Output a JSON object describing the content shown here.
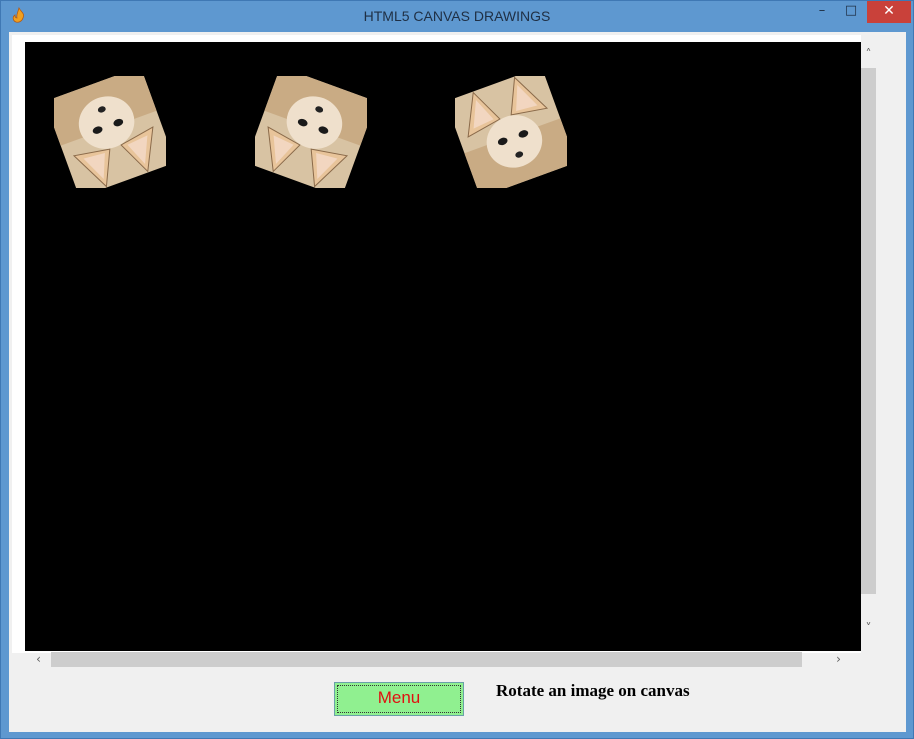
{
  "window": {
    "title": "HTML5 CANVAS DRAWINGS",
    "icon": "app-flame-icon",
    "controls": {
      "minimize": "minimize-icon",
      "maximize": "maximize-icon",
      "close": "close-icon"
    }
  },
  "canvas": {
    "background": "#000000",
    "images": [
      {
        "name": "rotated-fox-1",
        "rotation_deg": 160
      },
      {
        "name": "rotated-fox-2",
        "rotation_deg": 200
      },
      {
        "name": "rotated-fox-3",
        "rotation_deg": -20
      }
    ]
  },
  "scrollbars": {
    "vertical": true,
    "horizontal": true
  },
  "footer": {
    "menu_label": "Menu",
    "caption": "Rotate an image on canvas"
  },
  "colors": {
    "menu_bg": "#90f090",
    "menu_text": "#e01010",
    "close_btn": "#c9413a"
  }
}
